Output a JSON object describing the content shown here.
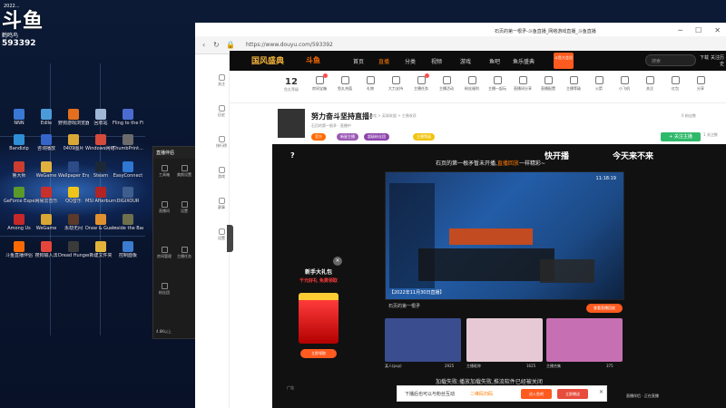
{
  "desktop": {
    "logo_text": "斗鱼",
    "logo_sub": "鹤鸣鸟",
    "logo_number": "593392",
    "top_label": "2022...",
    "icons": [
      {
        "label": "NNN",
        "color": "#3a78d6"
      },
      {
        "label": "Edlle",
        "color": "#4b9bd9"
      },
      {
        "label": "野狗游戏浏览器",
        "color": "#e36f1e"
      },
      {
        "label": "回收站",
        "color": "#9fb7d5"
      },
      {
        "label": "Fling to the Finish 修...",
        "color": "#4a6cd1"
      },
      {
        "label": "Bandizip",
        "color": "#2f8fd6"
      },
      {
        "label": "咨询播放",
        "color": "#3565c8"
      },
      {
        "label": "0409图片",
        "color": "#d9a836"
      },
      {
        "label": "Windows网络...",
        "color": "#d44a3b"
      },
      {
        "label": "ThumbPrint...",
        "color": "#6b6b6b"
      },
      {
        "label": "鲁大师",
        "color": "#cc3d2f"
      },
      {
        "label": "WeGame",
        "color": "#e0b23d"
      },
      {
        "label": "Wallpaper Engine",
        "color": "#2c4b87"
      },
      {
        "label": "Steam",
        "color": "#1b2838"
      },
      {
        "label": "EasyConnect",
        "color": "#2f77d1"
      },
      {
        "label": "GeForce Experience",
        "color": "#5a9a2b"
      },
      {
        "label": "网易云音乐",
        "color": "#c9302c"
      },
      {
        "label": "QQ音乐",
        "color": "#f0c419"
      },
      {
        "label": "MSI Afterburner",
        "color": "#b02424"
      },
      {
        "label": "DIGIXOUR",
        "color": "#3e5e8e"
      },
      {
        "label": "Among Us",
        "color": "#c62828"
      },
      {
        "label": "WeGame",
        "color": "#d8a733"
      },
      {
        "label": "永劫无间",
        "color": "#5b3a29"
      },
      {
        "label": "Draw & Guess",
        "color": "#e2902f"
      },
      {
        "label": "Inside the Backroo...",
        "color": "#6f6f4c"
      },
      {
        "label": "斗鱼直播伴侣",
        "color": "#ff6a00"
      },
      {
        "label": "搜狗输入法",
        "color": "#e4463b"
      },
      {
        "label": "Dread Hunger",
        "color": "#3a3a3a"
      },
      {
        "label": "新建文件夹",
        "color": "#e3b43c"
      },
      {
        "label": "控制面板",
        "color": "#3b7bd0"
      }
    ]
  },
  "float_panel": {
    "title": "直播伴侣",
    "items": [
      "工具箱",
      "美颜设置",
      "直播间",
      "设置",
      "房间管理",
      "主播任务",
      "粉丝团"
    ],
    "footer": "4.8K以上"
  },
  "browser": {
    "url": "https://www.douyu.com/593392",
    "tab_title": "石页的第一根矛-斗鱼直播_网络游戏直播_斗鱼直播",
    "buttons": [
      "─",
      "☐",
      "✕"
    ]
  },
  "leftbar": {
    "items": [
      "关注",
      "历史",
      "排行榜",
      "游戏",
      "赛事",
      "设置"
    ]
  },
  "topnav": {
    "brand": "国风盛典",
    "logo": "斗鱼",
    "links": [
      "首页",
      "直播",
      "分类",
      "视频",
      "游戏",
      "鱼吧",
      "鱼乐盛典"
    ],
    "active_index": 1,
    "promo": "斗鱼大会员",
    "search_placeholder": "搜索",
    "user_items": [
      "下载",
      "关注",
      "历史"
    ]
  },
  "catbar": {
    "level": "12",
    "level_label": "鱼丸等级",
    "items": [
      "房间宝箱",
      "鱼丸充值",
      "礼物",
      "大力支持",
      "主播任务",
      "主播活动",
      "粉丝福利",
      "主播一起玩",
      "直播间分享",
      "直播配置",
      "主播等级",
      "火箭",
      "小飞机",
      "关注",
      "红包",
      "分享"
    ]
  },
  "room": {
    "title": "努力奋斗坚持直播!",
    "subtitle": "网络游戏 > 英雄联盟 > 主播收获",
    "meta": "石页的第一根矛 · 直播中",
    "follow": "+ 关注主播",
    "tags": [
      {
        "label": "官方",
        "color": "#ff6a00"
      },
      {
        "label": "新星主播",
        "color": "#9b59b6"
      },
      {
        "label": "超级粉丝团",
        "color": "#8e44ad"
      },
      {
        "label": "主播等级",
        "color": "#f1c40f"
      }
    ],
    "right_stats": [
      "0 粉丝数",
      "1 关注数"
    ]
  },
  "player": {
    "question": "?",
    "banner_left": "快开播",
    "banner_right": "今天来不来",
    "offline_msg": "石页的第一根矛暂未开播,",
    "offline_link": "直播回放",
    "offline_msg_end": "一样精彩~",
    "screen_time": "11:18:19",
    "screen_caption": "【2022年11月30日直播】",
    "streamer_name": "石页的第一根矛",
    "view_replay": "查看直播回放",
    "thumbs": [
      {
        "caption": "某人(pvp)",
        "count": "2925",
        "color": "#3a4d8f"
      },
      {
        "caption": "主播昵称",
        "count": "1625",
        "color": "#e7c9d6"
      },
      {
        "caption": "主播合集",
        "count": "375",
        "color": "#c76fb3"
      }
    ],
    "gift": {
      "title": "新手大礼包",
      "subtitle": "千元好礼 免费领取",
      "button": "立即领取"
    },
    "error_msg": "加载失败:播放加载失败,推流软件已经被关闭",
    "ad_label": "广告"
  },
  "bottombar": {
    "text": "下播后也可以与粉丝互动",
    "link": "二维码扫码",
    "btn1": "进入鱼吧",
    "btn2": "立即赠送"
  },
  "status_right": "直播伴侣 · 正在直播"
}
